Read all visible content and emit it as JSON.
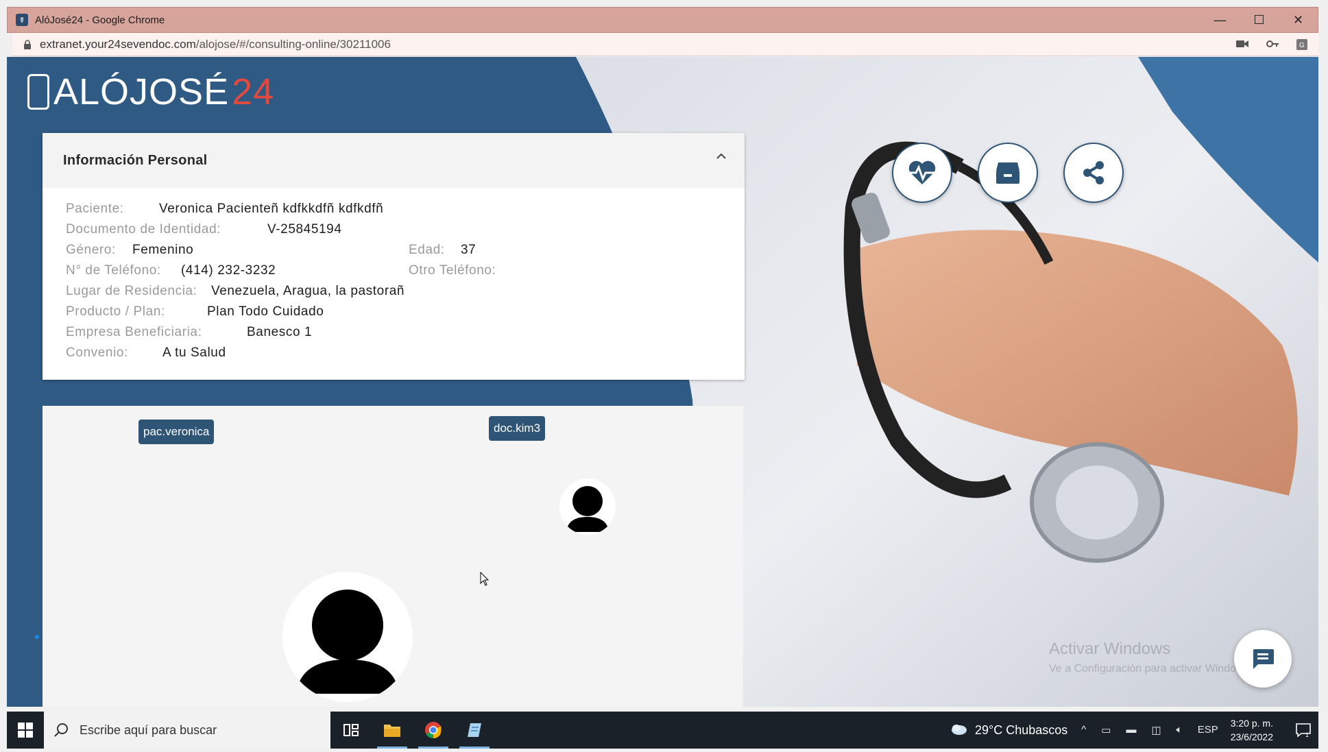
{
  "window": {
    "title": "AlóJosé24 - Google Chrome",
    "controls": {
      "minimize": "—",
      "maximize": "☐",
      "close": "✕"
    }
  },
  "address_bar": {
    "host": "extranet.your24sevendoc.com",
    "path": "/alojose/#/consulting-online/30211006"
  },
  "brand": {
    "name": "ALÓJOSÉ",
    "number": "24"
  },
  "personal_info": {
    "title": "Información Personal",
    "fields": {
      "patient_label": "Paciente:",
      "patient_value": "Veronica Pacienteñ kdfkkdfñ kdfkdfñ",
      "id_label": "Documento de Identidad:",
      "id_value": "V-25845194",
      "gender_label": "Género:",
      "gender_value": "Femenino",
      "age_label": "Edad:",
      "age_value": "37",
      "phone_label": "N° de Teléfono:",
      "phone_value": "(414) 232-3232",
      "other_phone_label": "Otro Teléfono:",
      "other_phone_value": "",
      "residence_label": "Lugar de Residencia:",
      "residence_value": "Venezuela, Aragua, la pastorañ",
      "plan_label": "Producto / Plan:",
      "plan_value": "Plan Todo Cuidado",
      "company_label": "Empresa Beneficiaria:",
      "company_value": "Banesco 1",
      "agreement_label": "Convenio:",
      "agreement_value": "A tu Salud"
    }
  },
  "video": {
    "patient_tag": "pac.veronica",
    "doctor_tag": "doc.kim3"
  },
  "actions": [
    {
      "name": "health",
      "icon": "heart-pulse-icon"
    },
    {
      "name": "records",
      "icon": "archive-box-icon"
    },
    {
      "name": "share",
      "icon": "share-icon"
    }
  ],
  "watermark": {
    "line1": "Activar Windows",
    "line2": "Ve a Configuración para activar Windows."
  },
  "taskbar": {
    "search_placeholder": "Escribe aquí para buscar",
    "weather": "29°C  Chubascos",
    "language": "ESP",
    "time": "3:20 p. m.",
    "date": "23/6/2022",
    "notifications": "1"
  },
  "colors": {
    "primary": "#2f5a84",
    "accent": "#e24a3d",
    "titlebar": "#d7a49c"
  }
}
